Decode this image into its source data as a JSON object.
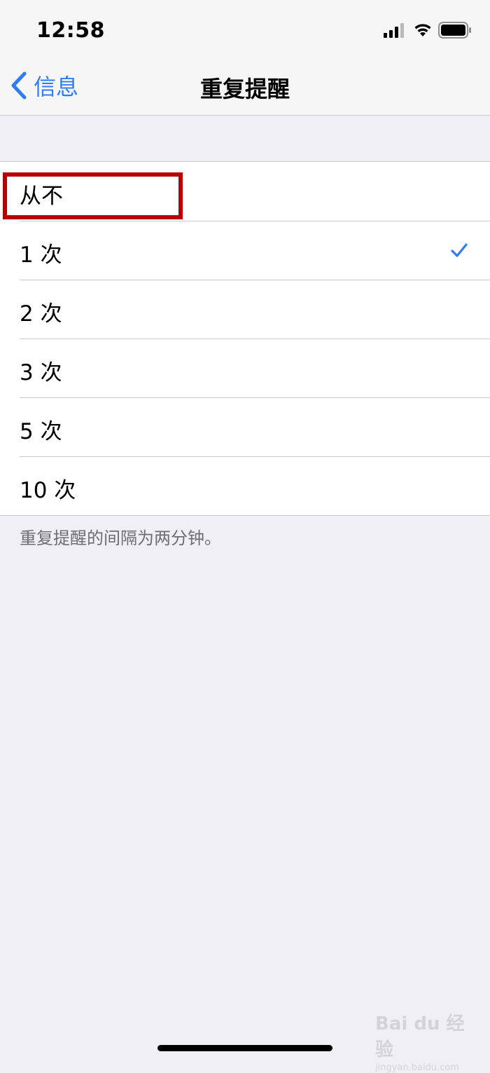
{
  "status_bar": {
    "time": "12:58"
  },
  "nav": {
    "back_label": "信息",
    "title": "重复提醒"
  },
  "accent_color": "#2f7cf6",
  "options": [
    {
      "label": "从不",
      "selected": false
    },
    {
      "label": "1 次",
      "selected": true
    },
    {
      "label": "2 次",
      "selected": false
    },
    {
      "label": "3 次",
      "selected": false
    },
    {
      "label": "5 次",
      "selected": false
    },
    {
      "label": "10 次",
      "selected": false
    }
  ],
  "footer_note": "重复提醒的间隔为两分钟。",
  "annotation": {
    "highlight_color": "#b70000",
    "highlighted_item": "从不"
  },
  "watermark": {
    "logo": "Bai du 经验",
    "url": "jingyan.baidu.com"
  }
}
